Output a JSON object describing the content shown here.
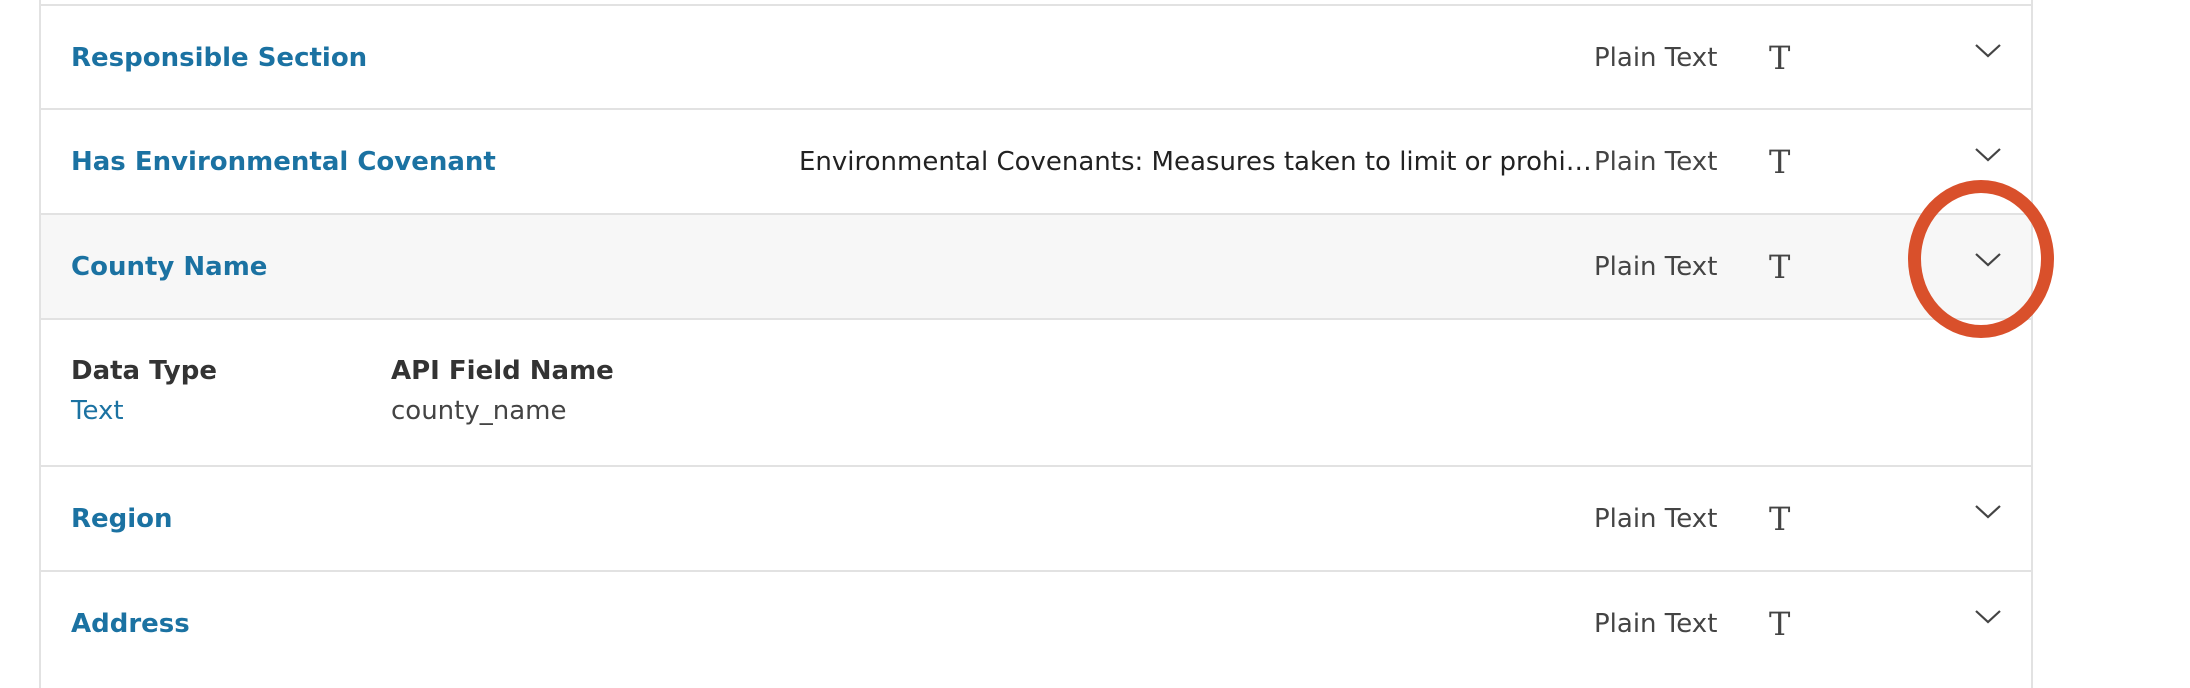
{
  "fields": [
    {
      "name": "Responsible Section",
      "description": "",
      "type": "Plain Text",
      "type_icon": "T"
    },
    {
      "name": "Has Environmental Covenant",
      "description": "Environmental Covenants: Measures taken to limit or prohi…",
      "type": "Plain Text",
      "type_icon": "T"
    },
    {
      "name": "County Name",
      "description": "",
      "type": "Plain Text",
      "type_icon": "T",
      "expanded": true
    },
    {
      "name": "Region",
      "description": "",
      "type": "Plain Text",
      "type_icon": "T"
    },
    {
      "name": "Address",
      "description": "",
      "type": "Plain Text",
      "type_icon": "T"
    }
  ],
  "details": {
    "data_type_label": "Data Type",
    "data_type_value": "Text",
    "api_field_label": "API Field Name",
    "api_field_value": "county_name"
  },
  "icons": {
    "expand": "chevron-down-icon",
    "type": "text-type-icon"
  },
  "colors": {
    "link": "#1b72a2",
    "highlight": "#d9502b",
    "active_row_bg": "#f7f7f7",
    "border": "#e2e2e2"
  }
}
